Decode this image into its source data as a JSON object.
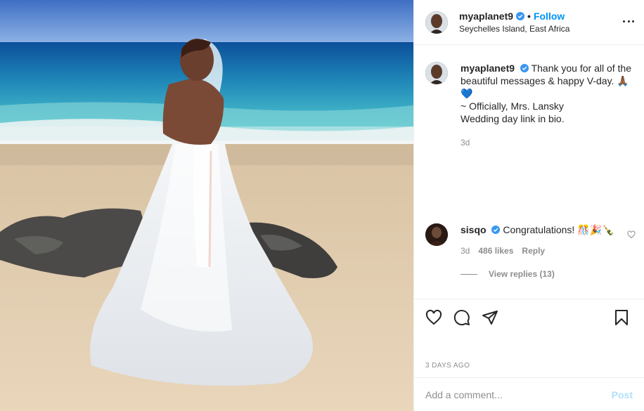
{
  "post": {
    "username": "myaplanet9",
    "separator": "•",
    "follow_label": "Follow",
    "location": "Seychelles Island, East Africa"
  },
  "caption": {
    "username": "myaplanet9",
    "text_line1": "Thank you for all of the beautiful messages & happy V-day. 🙏🏾",
    "text_line2": "💙",
    "text_line3": "~ Officially, Mrs. Lansky",
    "text_line4": "Wedding day link in bio.",
    "timestamp": "3d"
  },
  "comment": {
    "username": "sisqo",
    "text": "Congratulations! 🎊🎉🍾",
    "timestamp": "3d",
    "likes": "486 likes",
    "reply_label": "Reply"
  },
  "replies": {
    "label": "View replies (13)"
  },
  "date_posted": "3 DAYS AGO",
  "add_comment": {
    "placeholder": "Add a comment...",
    "post_label": "Post"
  },
  "icons": {
    "more": "more-options-icon",
    "verified": "verified-badge-icon",
    "like": "heart-icon",
    "comment": "comment-icon",
    "share": "share-icon",
    "save": "bookmark-icon"
  },
  "colors": {
    "accent": "#0095f6",
    "muted": "#8e8e8e",
    "text": "#262626",
    "post_disabled": "#b2dffc"
  }
}
